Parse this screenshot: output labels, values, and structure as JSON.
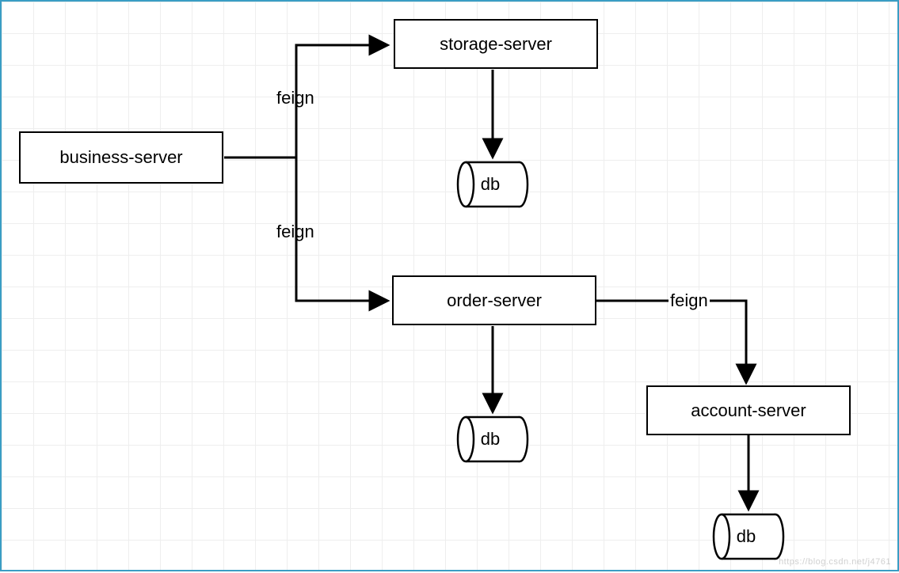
{
  "nodes": {
    "business": {
      "label": "business-server"
    },
    "storage": {
      "label": "storage-server"
    },
    "order": {
      "label": "order-server"
    },
    "account": {
      "label": "account-server"
    }
  },
  "db": {
    "storage": {
      "label": "db"
    },
    "order": {
      "label": "db"
    },
    "account": {
      "label": "db"
    }
  },
  "edges": {
    "biz_to_storage_label": "feign",
    "biz_to_order_label": "feign",
    "order_to_account_label": "feign"
  },
  "watermark": "https://blog.csdn.net/j4761"
}
